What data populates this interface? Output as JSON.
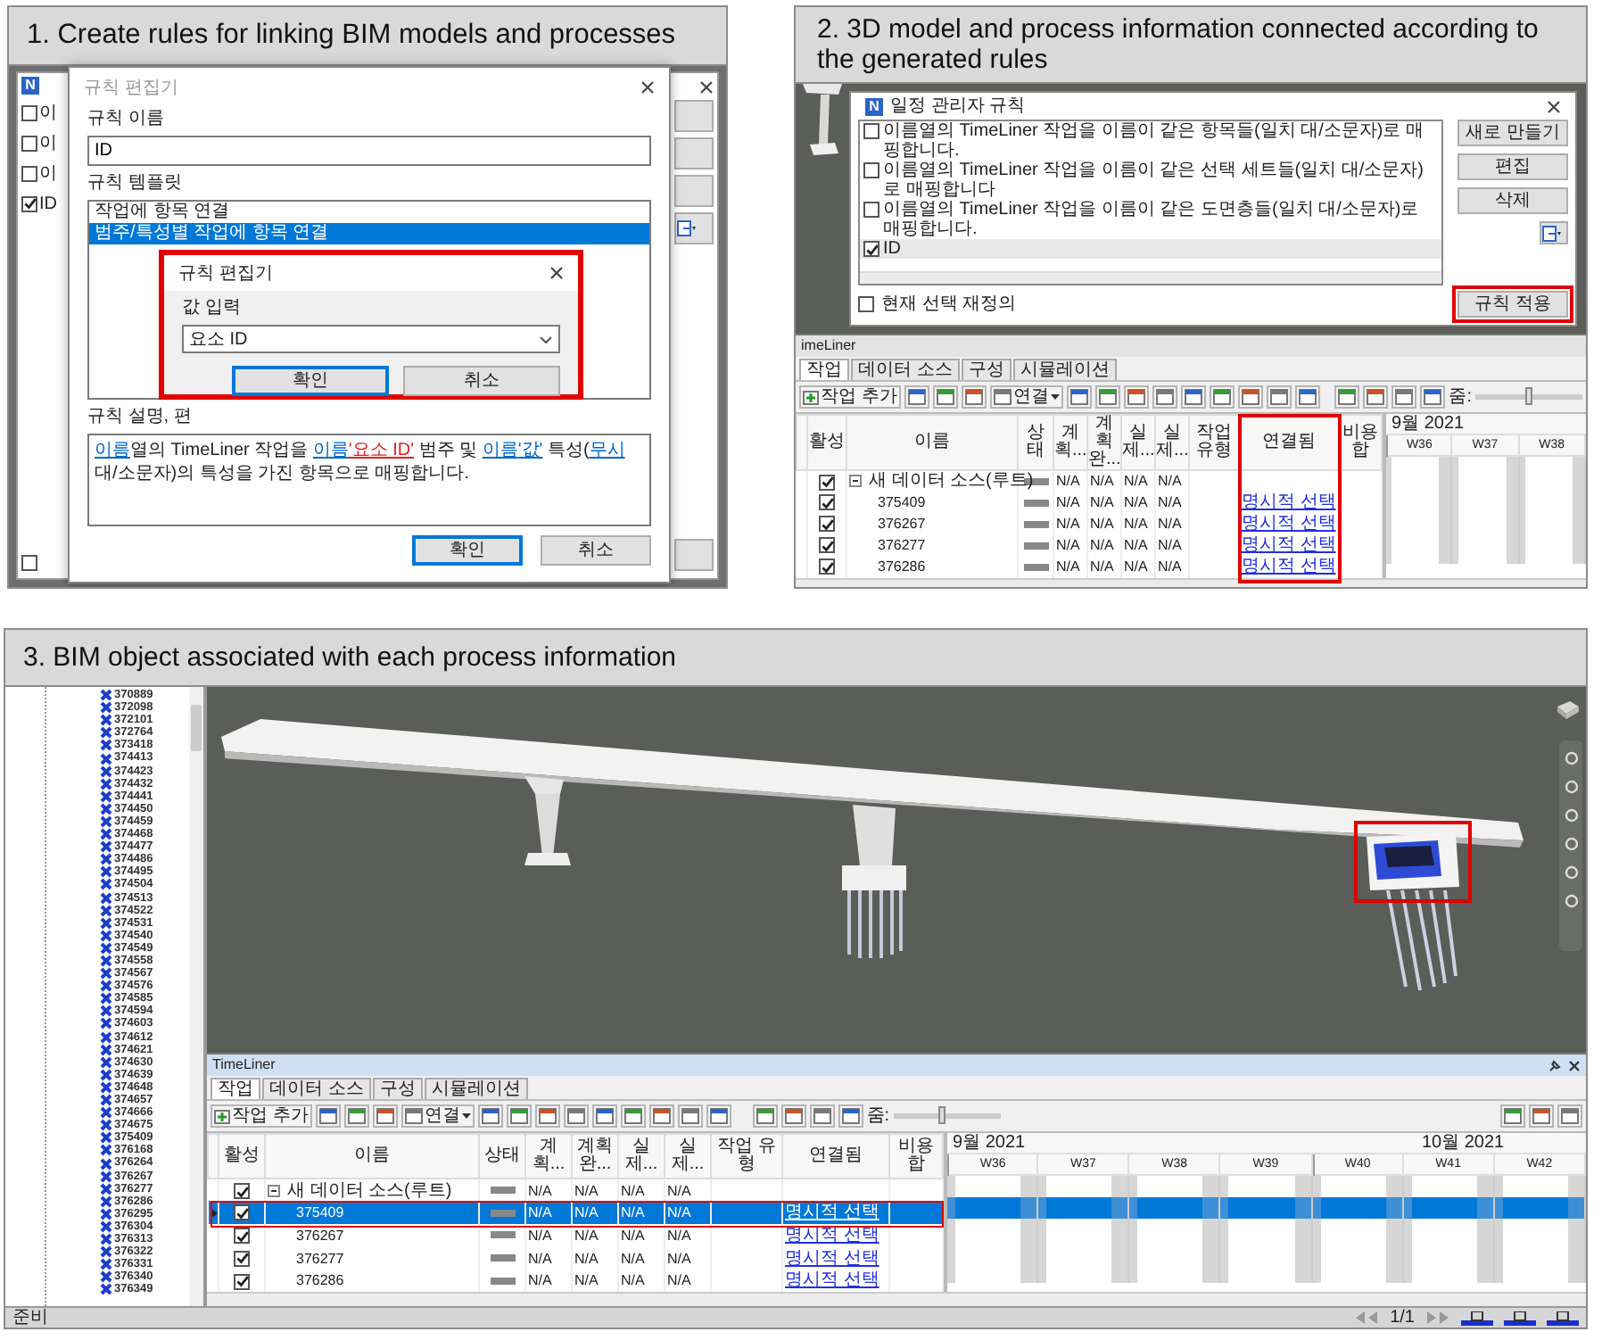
{
  "panel_1": {
    "caption": "1. Create rules for linking BIM models and processes",
    "background_window": {
      "logo": "N",
      "items": [
        {
          "label": "이",
          "checked": false
        },
        {
          "label": "이",
          "checked": false
        },
        {
          "label": "이",
          "checked": false
        },
        {
          "label": "ID",
          "checked": true
        }
      ],
      "bottom_checked": false
    },
    "rule_editor": {
      "title": "규칙 편집기",
      "name_label": "규칙 이름",
      "name_value": "ID",
      "template_label": "규칙 템플릿",
      "templates": [
        {
          "label": "작업에 항목 연결",
          "selected": false
        },
        {
          "label": "범주/특성별 작업에 항목 연결",
          "selected": true
        }
      ],
      "description_label": "규칙 설명, 편",
      "description": [
        {
          "text": "이름",
          "kind": "link"
        },
        {
          "text": "열의 TimeLiner 작업을 ",
          "kind": "plain"
        },
        {
          "text": "이름",
          "kind": "link"
        },
        {
          "text": "'요소 ID'",
          "kind": "value"
        },
        {
          "text": " 범주 및 ",
          "kind": "plain"
        },
        {
          "text": "이름",
          "kind": "link"
        },
        {
          "text": "'값'",
          "kind": "link"
        },
        {
          "text": " 특성(",
          "kind": "plain"
        },
        {
          "text": "무시",
          "kind": "link"
        },
        {
          "text": " 대/소문자)의 특성을 가진 항목으로 매핑합니다.",
          "kind": "plain"
        }
      ],
      "buttons": [
        {
          "label": "확인",
          "default": true
        },
        {
          "label": "취소",
          "default": false
        }
      ]
    },
    "value_dialog": {
      "title": "규칙 편집기",
      "label": "값 입력",
      "value": "요소 ID",
      "buttons": [
        {
          "label": "확인",
          "default": true
        },
        {
          "label": "취소",
          "default": false
        }
      ]
    }
  },
  "panel_2": {
    "caption": "2. 3D model and process information connected according to the generated rules",
    "rules_dialog": {
      "logo": "N",
      "title": "일정 관리자 규칙",
      "rules": [
        {
          "label": "이름열의 TimeLiner 작업을 이름이 같은 항목들(일치 대/소문자)로 매핑합니다.",
          "checked": false,
          "selected": false
        },
        {
          "label": "이름열의 TimeLiner 작업을 이름이 같은 선택 세트들(일치 대/소문자)로 매핑합니다",
          "checked": false,
          "selected": false
        },
        {
          "label": "이름열의 TimeLiner 작업을 이름이 같은 도면층들(일치 대/소문자)로 매핑합니다.",
          "checked": false,
          "selected": false
        },
        {
          "label": "ID",
          "checked": true,
          "selected": true
        }
      ],
      "side_buttons": [
        "새로 만들기",
        "편집",
        "삭제"
      ],
      "override": {
        "label": "현재 선택 재정의",
        "checked": false
      },
      "apply_button": "규칙 적용"
    },
    "timeliner": {
      "title": "imeLiner",
      "active": false,
      "link_column_highlighted": true,
      "tabs": [
        {
          "label": "작업",
          "selected": true
        },
        {
          "label": "데이터 소스",
          "selected": false
        },
        {
          "label": "구성",
          "selected": false
        },
        {
          "label": "시뮬레이션",
          "selected": false
        }
      ],
      "toolbar": {
        "add_task": "작업 추가",
        "link": "연결",
        "zoom_label": "줌:",
        "zoom_slider": {
          "level": 0.5
        }
      },
      "columns": [
        "활성",
        "이름",
        "상태",
        "계획...",
        "계획 완...",
        "실제...",
        "실제...",
        "작업 유형",
        "연결됨",
        "비용 합"
      ],
      "rows": [
        {
          "kind": "root",
          "active": true,
          "name": "새 데이터 소스(루트)",
          "dates": [
            "N/A",
            "N/A",
            "N/A",
            "N/A"
          ],
          "selected": false
        },
        {
          "kind": "task",
          "active": true,
          "name": "375409",
          "dates": [
            "N/A",
            "N/A",
            "N/A",
            "N/A"
          ],
          "link": "명시적 선택",
          "selected": false
        },
        {
          "kind": "task",
          "active": true,
          "name": "376267",
          "dates": [
            "N/A",
            "N/A",
            "N/A",
            "N/A"
          ],
          "link": "명시적 선택",
          "selected": false
        },
        {
          "kind": "task",
          "active": true,
          "name": "376277",
          "dates": [
            "N/A",
            "N/A",
            "N/A",
            "N/A"
          ],
          "link": "명시적 선택",
          "selected": false
        },
        {
          "kind": "task",
          "active": true,
          "name": "376286",
          "dates": [
            "N/A",
            "N/A",
            "N/A",
            "N/A"
          ],
          "link": "명시적 선택",
          "selected": false
        }
      ],
      "months": [
        "9월 2021"
      ],
      "weeks": [
        {
          "label": "W36",
          "month_start": true
        },
        {
          "label": "W37",
          "month_start": false
        },
        {
          "label": "W38",
          "month_start": false
        }
      ]
    }
  },
  "panel_3": {
    "caption": "3. BIM object associated with each process information",
    "tree_items": [
      "370889",
      "372098",
      "372101",
      "372764",
      "373418",
      "374413",
      "374423",
      "374432",
      "374441",
      "374450",
      "374459",
      "374468",
      "374477",
      "374486",
      "374495",
      "374504",
      "374513",
      "374522",
      "374531",
      "374540",
      "374549",
      "374558",
      "374567",
      "374576",
      "374585",
      "374594",
      "374603",
      "374612",
      "374621",
      "374630",
      "374639",
      "374648",
      "374657",
      "374666",
      "374675",
      "375409",
      "376168",
      "376264",
      "376267",
      "376277",
      "376286",
      "376295",
      "376304",
      "376313",
      "376322",
      "376331",
      "376340",
      "376349"
    ],
    "timeliner": {
      "title": "TimeLiner",
      "active": true,
      "tabs": [
        {
          "label": "작업",
          "selected": true
        },
        {
          "label": "데이터 소스",
          "selected": false
        },
        {
          "label": "구성",
          "selected": false
        },
        {
          "label": "시뮬레이션",
          "selected": false
        }
      ],
      "toolbar": {
        "add_task": "작업 추가",
        "link": "연결",
        "zoom_label": "줌:",
        "zoom_slider": {
          "level": 0.45
        },
        "export_tools": true
      },
      "columns": [
        "활성",
        "이름",
        "상태",
        "계획...",
        "계획 완...",
        "실제...",
        "실제...",
        "작업 유형",
        "연결됨",
        "비용 합"
      ],
      "rows": [
        {
          "kind": "root",
          "active": true,
          "name": "새 데이터 소스(루트)",
          "dates": [
            "N/A",
            "N/A",
            "N/A",
            "N/A"
          ],
          "selected": false
        },
        {
          "kind": "task",
          "active": true,
          "name": "375409",
          "dates": [
            "N/A",
            "N/A",
            "N/A",
            "N/A"
          ],
          "link": "명시적 선택",
          "selected": true,
          "highlighted": true
        },
        {
          "kind": "task",
          "active": true,
          "name": "376267",
          "dates": [
            "N/A",
            "N/A",
            "N/A",
            "N/A"
          ],
          "link": "명시적 선택",
          "selected": false
        },
        {
          "kind": "task",
          "active": true,
          "name": "376277",
          "dates": [
            "N/A",
            "N/A",
            "N/A",
            "N/A"
          ],
          "link": "명시적 선택",
          "selected": false
        },
        {
          "kind": "task",
          "active": true,
          "name": "376286",
          "dates": [
            "N/A",
            "N/A",
            "N/A",
            "N/A"
          ],
          "link": "명시적 선택",
          "selected": false
        }
      ],
      "months": [
        "9월 2021",
        "10월 2021"
      ],
      "weeks": [
        {
          "label": "W36",
          "month_start": true
        },
        {
          "label": "W37",
          "month_start": false
        },
        {
          "label": "W38",
          "month_start": false
        },
        {
          "label": "W39",
          "month_start": false
        },
        {
          "label": "W40",
          "month_start": true
        },
        {
          "label": "W41",
          "month_start": false
        },
        {
          "label": "W42",
          "month_start": false
        }
      ]
    },
    "status_bar": {
      "text": "준비",
      "page": "1/1"
    }
  }
}
